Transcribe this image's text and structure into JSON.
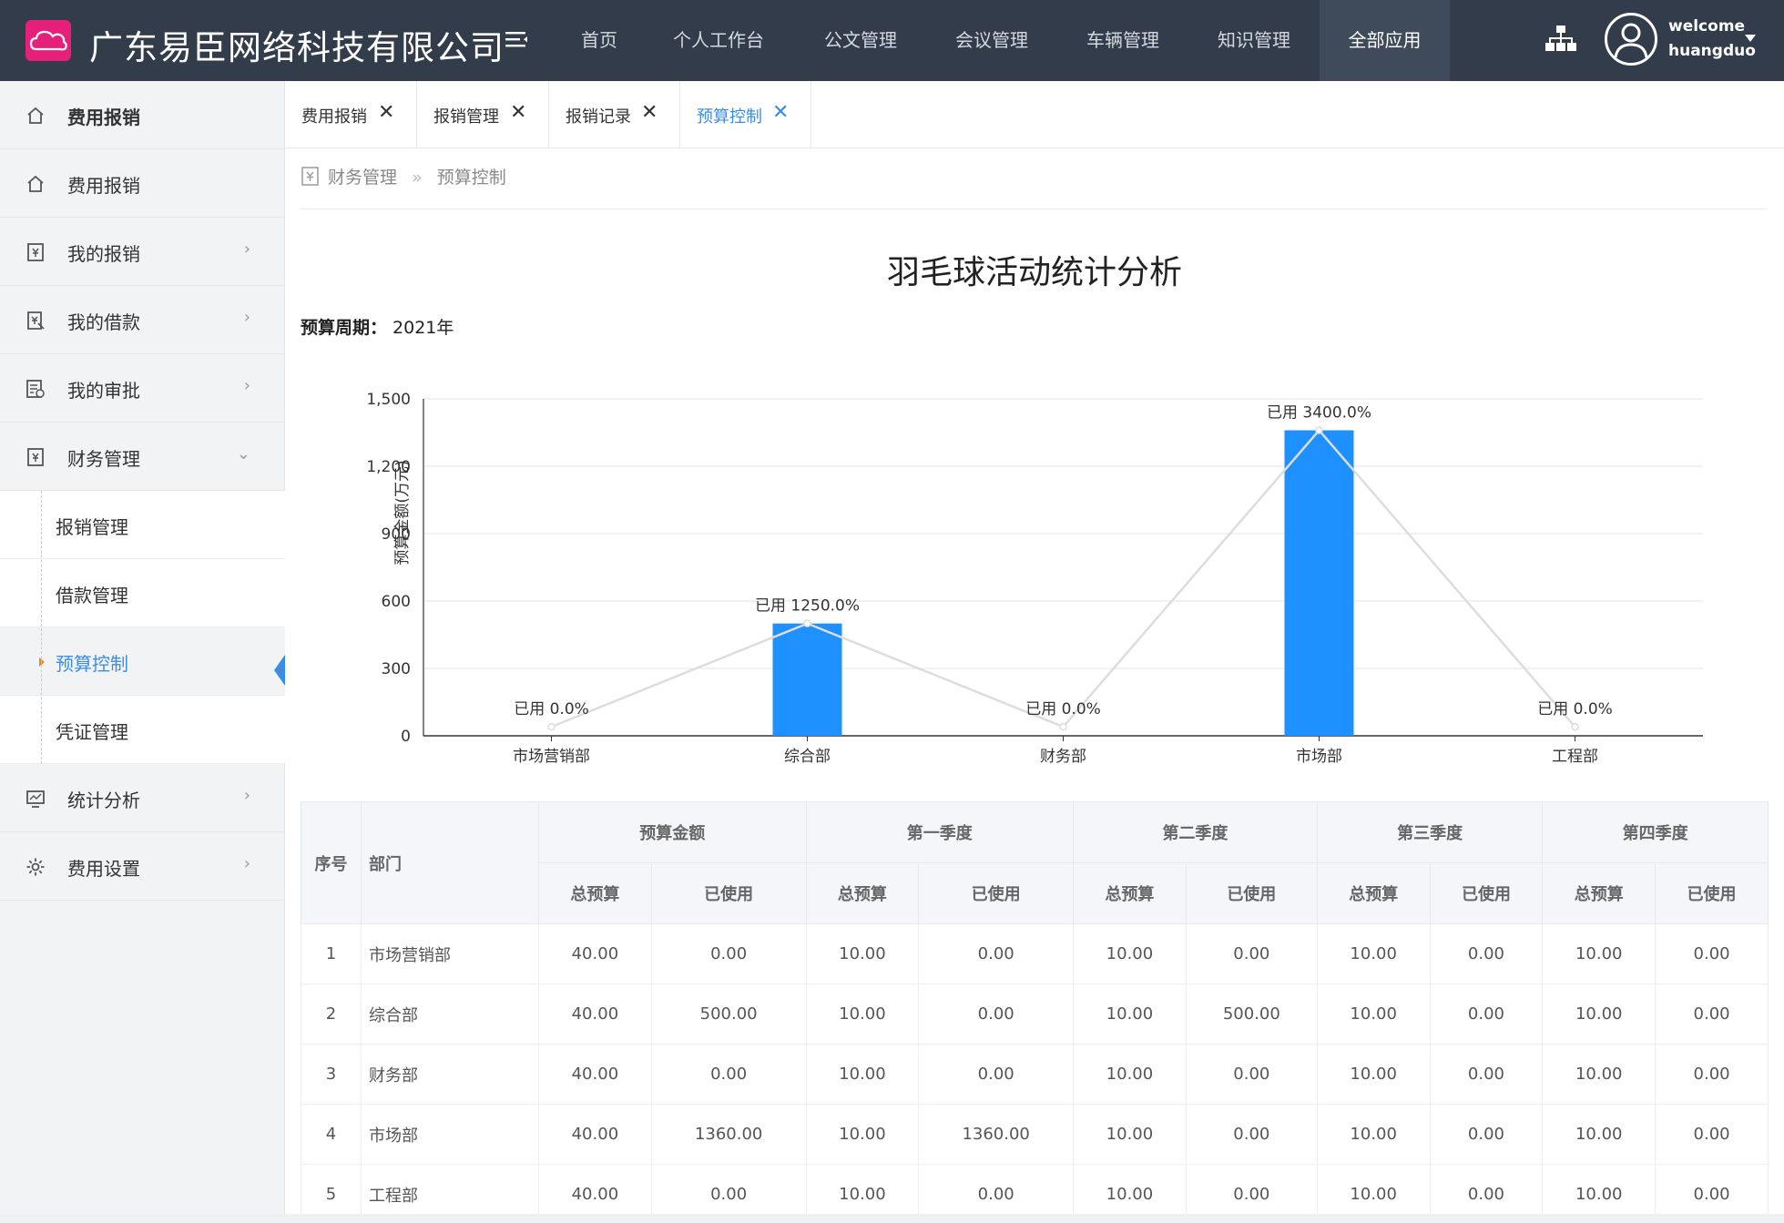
{
  "header": {
    "company": "广东易臣网络科技有限公司",
    "nav": [
      {
        "label": "首页",
        "active": false
      },
      {
        "label": "个人工作台",
        "active": false
      },
      {
        "label": "公文管理",
        "active": false
      },
      {
        "label": "会议管理",
        "active": false
      },
      {
        "label": "车辆管理",
        "active": false
      },
      {
        "label": "知识管理",
        "active": false
      },
      {
        "label": "全部应用",
        "active": true
      }
    ],
    "welcome": "welcome",
    "username": "huangduo"
  },
  "sidebar": {
    "items": [
      {
        "label": "费用报销",
        "icon": "home-icon",
        "bold": true
      },
      {
        "label": "费用报销",
        "icon": "home-icon"
      },
      {
        "label": "我的报销",
        "icon": "receipt-icon",
        "arrow": "›"
      },
      {
        "label": "我的借款",
        "icon": "loan-icon",
        "arrow": "›"
      },
      {
        "label": "我的审批",
        "icon": "approval-icon",
        "arrow": "›"
      },
      {
        "label": "财务管理",
        "icon": "finance-icon",
        "arrow": "⌄"
      }
    ],
    "sub_items": [
      {
        "label": "报销管理",
        "active": false
      },
      {
        "label": "借款管理",
        "active": false
      },
      {
        "label": "预算控制",
        "active": true
      },
      {
        "label": "凭证管理",
        "active": false
      }
    ],
    "bottom_items": [
      {
        "label": "统计分析",
        "icon": "chart-icon",
        "arrow": "›"
      },
      {
        "label": "费用设置",
        "icon": "gear-icon",
        "arrow": "›"
      }
    ]
  },
  "tabs": [
    {
      "label": "费用报销",
      "active": false
    },
    {
      "label": "报销管理",
      "active": false
    },
    {
      "label": "报销记录",
      "active": false
    },
    {
      "label": "预算控制",
      "active": true
    }
  ],
  "breadcrumb": {
    "parent": "财务管理",
    "separator": "»",
    "current": "预算控制"
  },
  "page": {
    "title": "羽毛球活动统计分析",
    "period_label": "预算周期：",
    "period_value": "2021年"
  },
  "chart_data": {
    "type": "bar",
    "categories": [
      "市场营销部",
      "综合部",
      "财务部",
      "市场部",
      "工程部"
    ],
    "ylabel": "预算金额(万元)",
    "ylim": [
      0,
      1500
    ],
    "yticks": [
      "0",
      "300",
      "600",
      "900",
      "1,200",
      "1,500"
    ],
    "series": [
      {
        "kind": "bar",
        "values": [
          0,
          500,
          0,
          1360,
          0
        ],
        "color": "#1e90ff"
      },
      {
        "kind": "line",
        "values": [
          40,
          500,
          40,
          1360,
          40
        ],
        "color": "#dddddd"
      }
    ],
    "data_labels": [
      "已用 0.0%",
      "已用 1250.0%",
      "已用 0.0%",
      "已用 3400.0%",
      "已用 0.0%"
    ],
    "grid": true
  },
  "table": {
    "headers": {
      "index": "序号",
      "dept": "部门",
      "groups": [
        "预算金额",
        "第一季度",
        "第二季度",
        "第三季度",
        "第四季度"
      ],
      "sub": [
        "总预算",
        "已使用"
      ]
    },
    "rows": [
      {
        "index": "1",
        "dept": "市场营销部",
        "values": [
          "40.00",
          "0.00",
          "10.00",
          "0.00",
          "10.00",
          "0.00",
          "10.00",
          "0.00",
          "10.00",
          "0.00"
        ]
      },
      {
        "index": "2",
        "dept": "综合部",
        "values": [
          "40.00",
          "500.00",
          "10.00",
          "0.00",
          "10.00",
          "500.00",
          "10.00",
          "0.00",
          "10.00",
          "0.00"
        ]
      },
      {
        "index": "3",
        "dept": "财务部",
        "values": [
          "40.00",
          "0.00",
          "10.00",
          "0.00",
          "10.00",
          "0.00",
          "10.00",
          "0.00",
          "10.00",
          "0.00"
        ]
      },
      {
        "index": "4",
        "dept": "市场部",
        "values": [
          "40.00",
          "1360.00",
          "10.00",
          "1360.00",
          "10.00",
          "0.00",
          "10.00",
          "0.00",
          "10.00",
          "0.00"
        ]
      },
      {
        "index": "5",
        "dept": "工程部",
        "values": [
          "40.00",
          "0.00",
          "10.00",
          "0.00",
          "10.00",
          "0.00",
          "10.00",
          "0.00",
          "10.00",
          "0.00"
        ]
      }
    ]
  }
}
